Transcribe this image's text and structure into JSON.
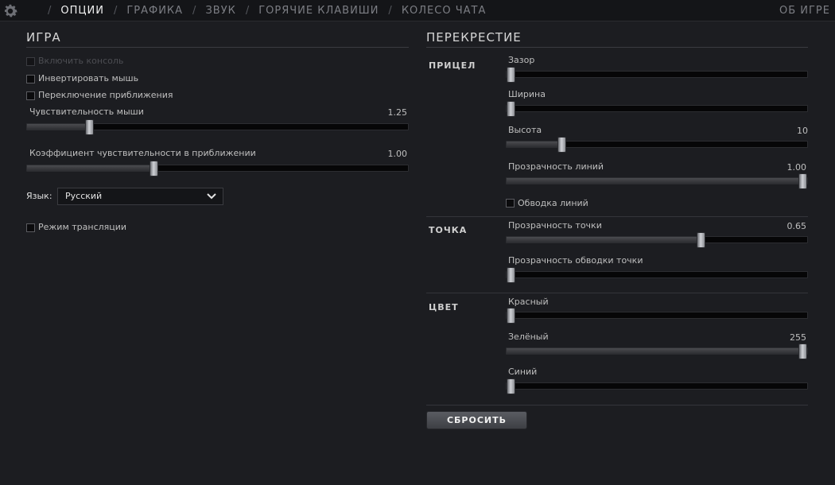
{
  "nav": {
    "tabs": [
      "ОПЦИИ",
      "ГРАФИКА",
      "ЗВУК",
      "ГОРЯЧИЕ КЛАВИШИ",
      "КОЛЕСО ЧАТА"
    ],
    "active_tab": "ОПЦИИ",
    "about": "ОБ ИГРЕ"
  },
  "game": {
    "title": "ИГРА",
    "checkbox_disabled_label": "Включить консоль",
    "invert_mouse": "Инвертировать мышь",
    "zoom_toggle": "Переключение приближения",
    "mouse_sensitivity": {
      "label": "Чувствительность мыши",
      "value": "1.25",
      "fraction": 0.155
    },
    "zoom_sensitivity": {
      "label": "Коэффициент чувствительности в приближении",
      "value": "1.00",
      "fraction": 0.33
    },
    "language_label": "Язык:",
    "language_value": "Русский",
    "streamer_mode": "Режим трансляции"
  },
  "crosshair": {
    "title": "ПЕРЕКРЕСТИЕ",
    "aim_group": "ПРИЦЕЛ",
    "gap": {
      "label": "Зазор",
      "fraction": 0.0
    },
    "width": {
      "label": "Ширина",
      "fraction": 0.0
    },
    "height": {
      "label": "Высота",
      "value": "10",
      "fraction": 0.175
    },
    "line_opacity": {
      "label": "Прозрачность линий",
      "value": "1.00",
      "fraction": 1.0
    },
    "line_outline": "Обводка линий",
    "dot_group": "ТОЧКА",
    "dot_opacity": {
      "label": "Прозрачность точки",
      "value": "0.65",
      "fraction": 0.65
    },
    "dot_outline_opacity": {
      "label": "Прозрачность обводки точки",
      "fraction": 0.0
    },
    "color_group": "ЦВЕТ",
    "red": {
      "label": "Красный",
      "fraction": 0.0
    },
    "green": {
      "label": "Зелёный",
      "value": "255",
      "fraction": 1.0
    },
    "blue": {
      "label": "Синий",
      "fraction": 0.0
    },
    "reset": "СБРОСИТЬ"
  }
}
